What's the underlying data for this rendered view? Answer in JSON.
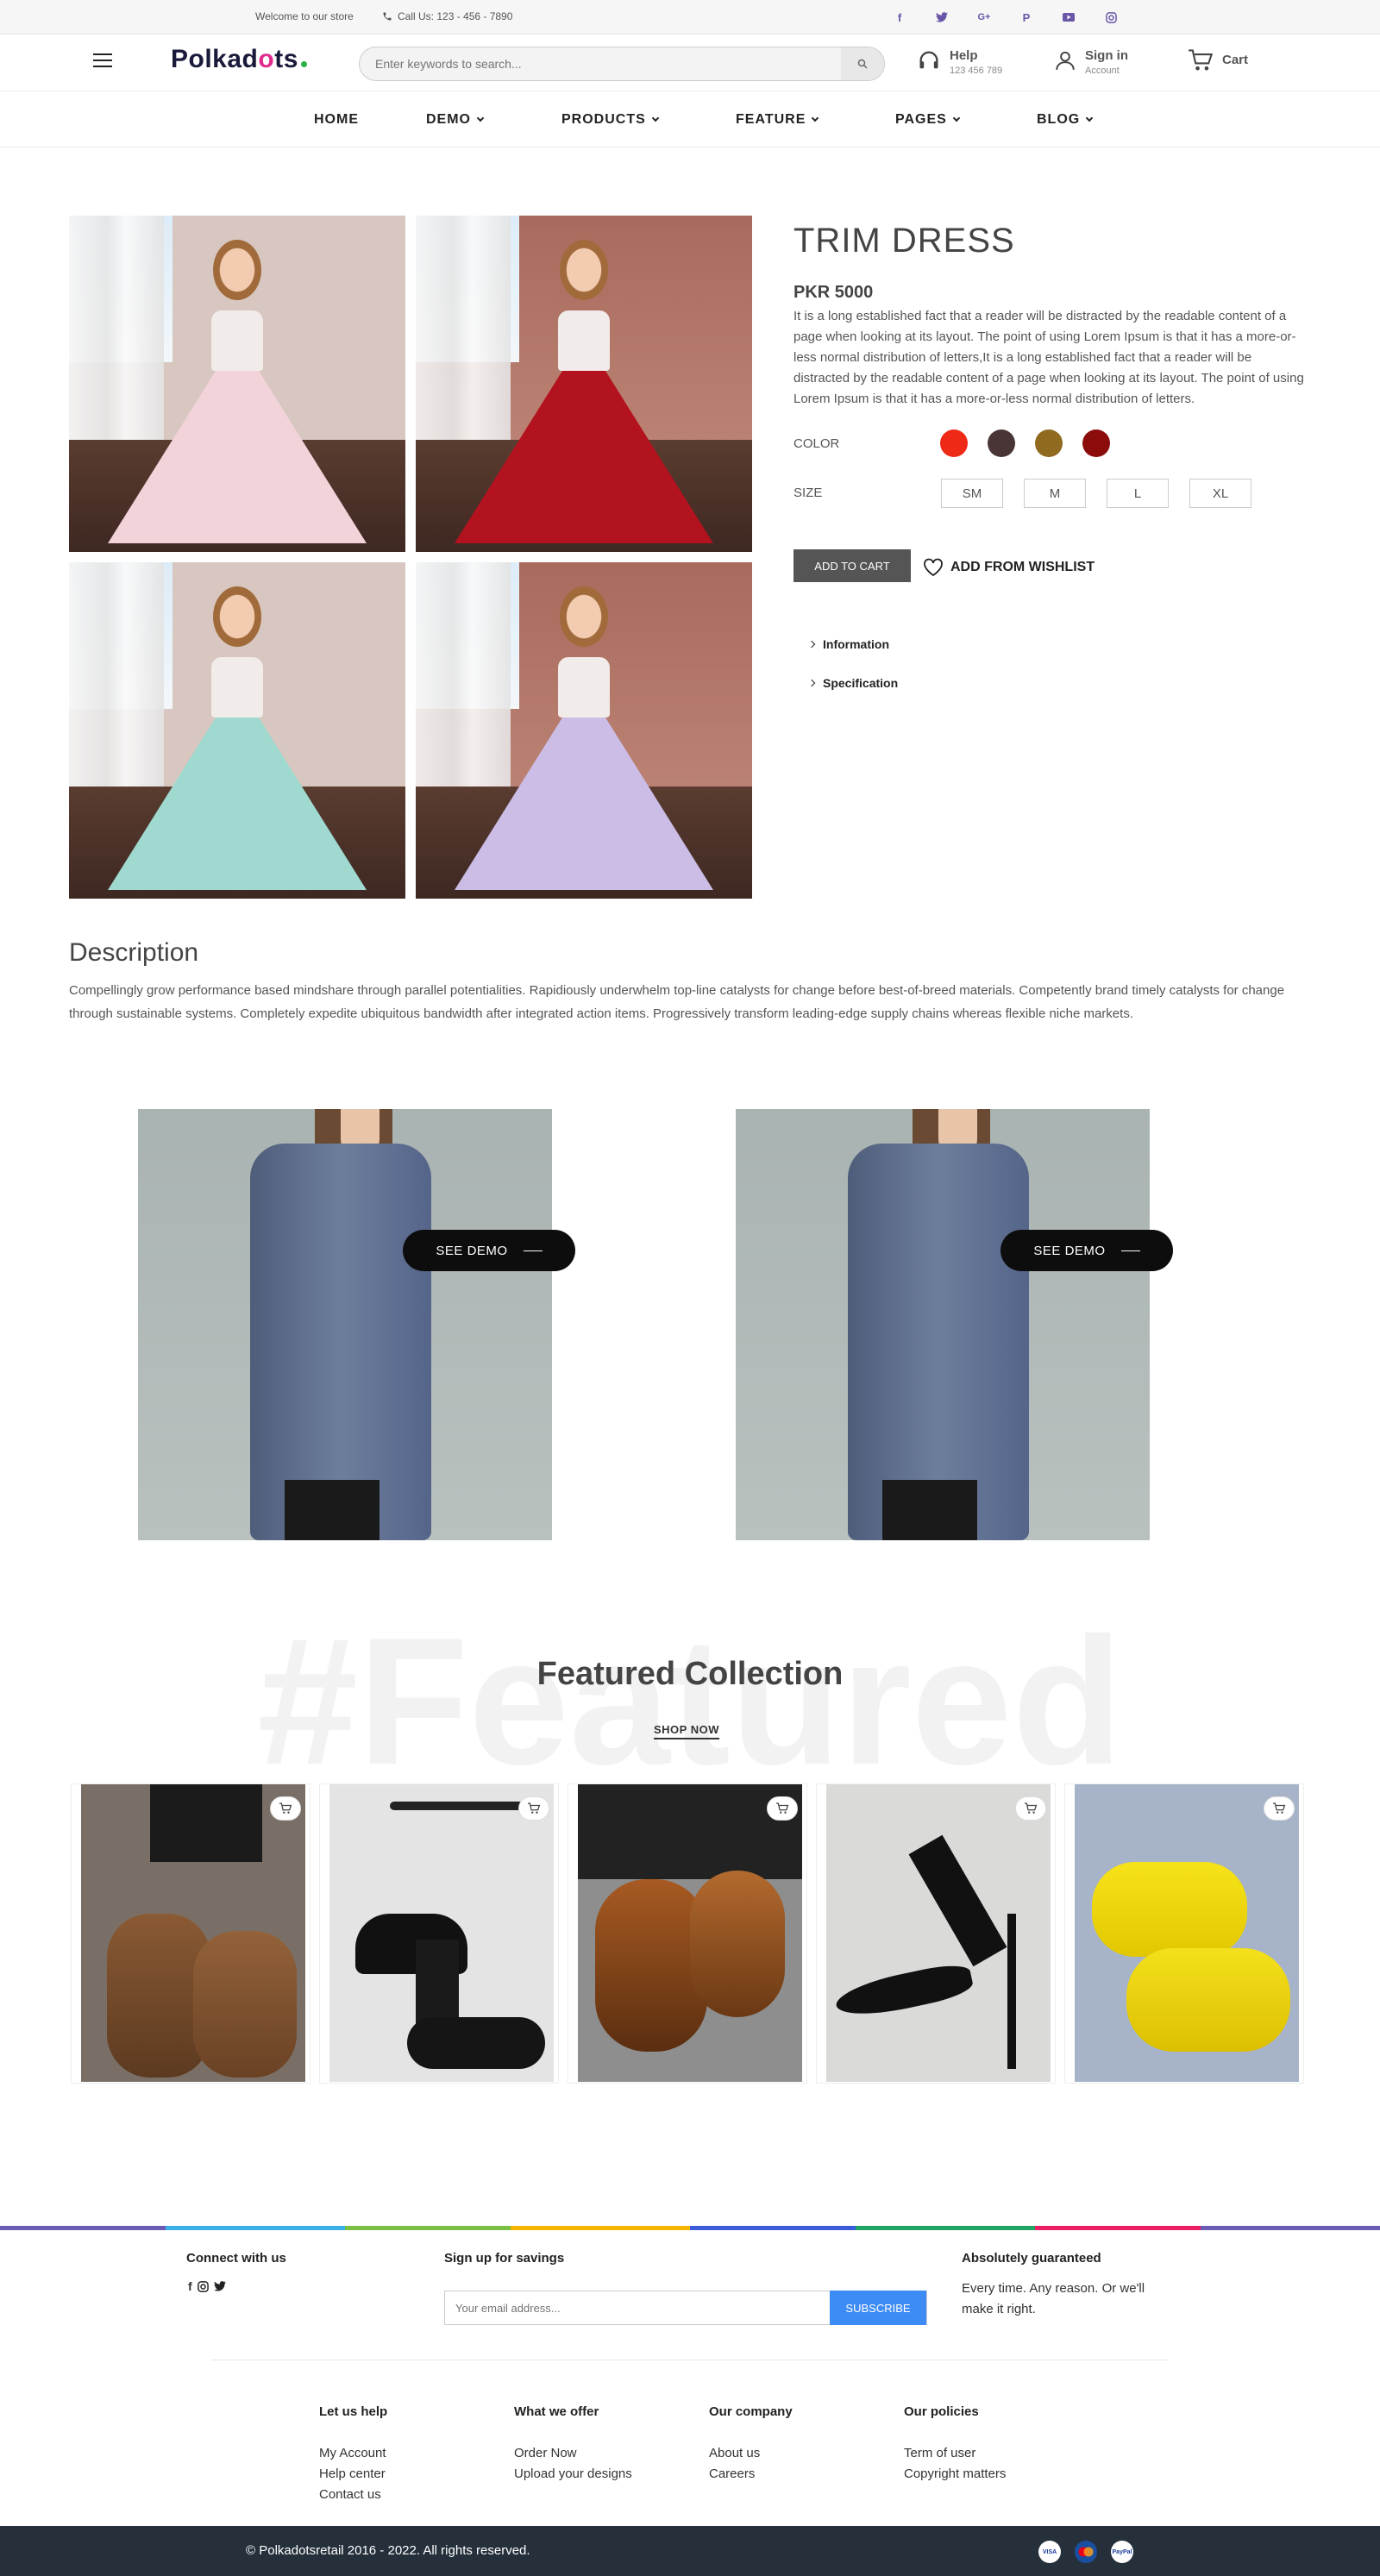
{
  "topbar": {
    "welcome": "Welcome to our store",
    "phone": "Call Us: 123 - 456 - 7890",
    "social_icons": [
      "facebook-icon",
      "twitter-icon",
      "google-plus-icon",
      "pinterest-icon",
      "youtube-icon",
      "instagram-icon"
    ]
  },
  "header": {
    "logo": "Polkadots",
    "search_placeholder": "Enter keywords to search...",
    "help_label": "Help",
    "help_sub": "123 456 789",
    "signin_label": "Sign in",
    "signin_sub": "Account",
    "cart_label": "Cart"
  },
  "nav": {
    "items": [
      {
        "label": "HOME",
        "dropdown": false
      },
      {
        "label": "DEMO",
        "dropdown": true
      },
      {
        "label": "PRODUCTS",
        "dropdown": true
      },
      {
        "label": "FEATURE",
        "dropdown": true
      },
      {
        "label": "PAGES",
        "dropdown": true
      },
      {
        "label": "BLOG",
        "dropdown": true
      }
    ]
  },
  "product": {
    "title": "TRIM DRESS",
    "price": "PKR 5000",
    "description": "It is a long established fact that a reader will be distracted by the readable content of a page when looking at its layout. The point of using Lorem Ipsum is that it has a more-or-less normal distribution of letters,It is a long established fact that a reader will be distracted by the readable content of a page when looking at its layout. The point of using Lorem Ipsum is that it has a more-or-less normal distribution of letters.",
    "color_label": "COLOR",
    "colors": [
      "#ee2a16",
      "#4a3536",
      "#8f6a1f",
      "#8c0c0c"
    ],
    "size_label": "SIZE",
    "sizes": [
      "SM",
      "M",
      "L",
      "XL"
    ],
    "add_to_cart": "ADD TO CART",
    "wishlist": "ADD FROM WISHLIST",
    "accordion": [
      "Information",
      "Specification"
    ],
    "image_dress_colors": [
      "#f2d3da",
      "#b3131e",
      "#9fd9d0",
      "#cbbde6"
    ]
  },
  "description": {
    "title": "Description",
    "text": "Compellingly grow performance based mindshare through parallel potentialities. Rapidiously underwhelm top-line catalysts for change before best-of-breed materials. Competently brand timely catalysts for change through sustainable systems. Completely expedite ubiquitous bandwidth after integrated action items. Progressively transform leading-edge supply chains whereas flexible niche markets."
  },
  "demo": {
    "button_label": "SEE DEMO"
  },
  "featured": {
    "watermark": "#Featured",
    "title": "Featured Collection",
    "shop_now": "SHOP NOW",
    "products": [
      "brown-leather-boot",
      "black-block-heel",
      "brown-oxford-shoe",
      "black-stiletto-sandal",
      "yellow-sneaker"
    ]
  },
  "footer": {
    "connect_title": "Connect with us",
    "signup_title": "Sign up for savings",
    "email_placeholder": "Your email address...",
    "subscribe": "SUBSCRIBE",
    "guarantee_title": "Absolutely guaranteed",
    "guarantee_text": "Every time. Any reason. Or we'll make it right.",
    "columns": [
      {
        "title": "Let us help",
        "links": [
          "My Account",
          "Help center",
          "Contact us"
        ]
      },
      {
        "title": "What we offer",
        "links": [
          "Order Now",
          "Upload your designs"
        ]
      },
      {
        "title": "Our company",
        "links": [
          "About us",
          "Careers"
        ]
      },
      {
        "title": "Our policies",
        "links": [
          "Term of user",
          "Copyright matters"
        ]
      }
    ],
    "copyright": "© Polkadotsretail 2016 - 2022. All rights reserved.",
    "payments": [
      "VISA",
      "MC",
      "PayPal"
    ]
  }
}
